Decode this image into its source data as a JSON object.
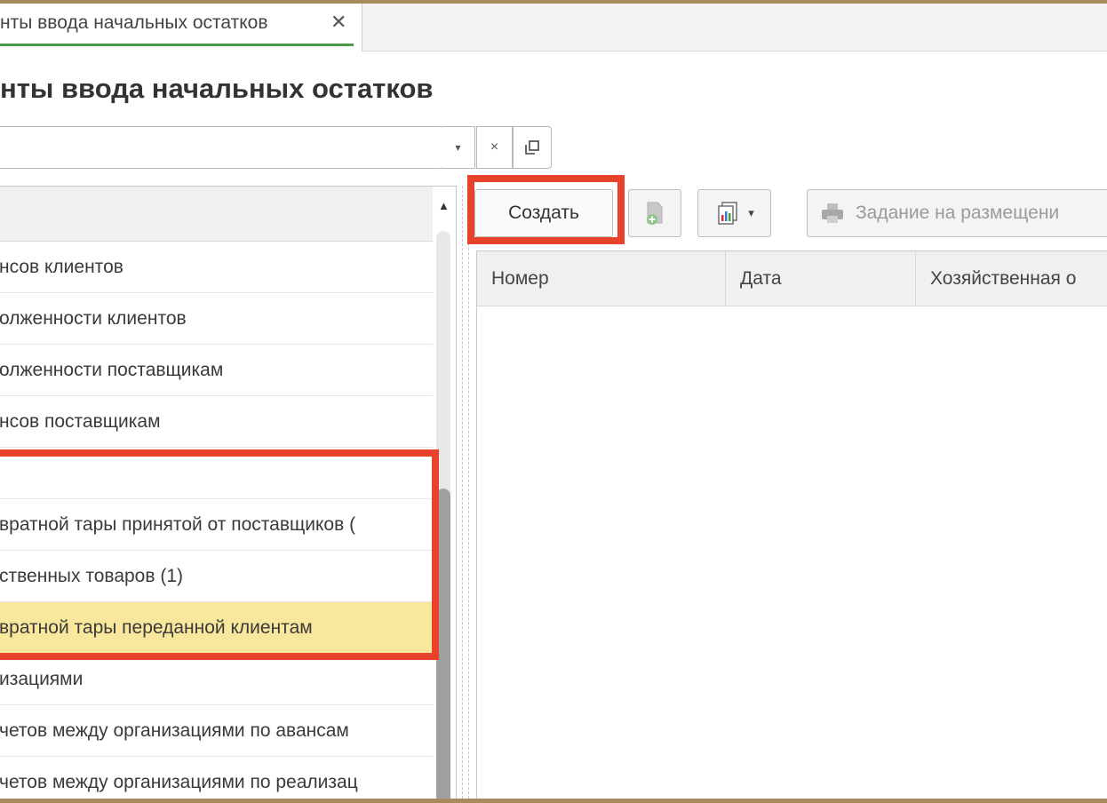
{
  "tab": {
    "title": "нты ввода начальных остатков",
    "close_glyph": "✕"
  },
  "page": {
    "title": "нты ввода начальных остатков"
  },
  "selector": {
    "dropdown_glyph": "▾",
    "clear_glyph": "×"
  },
  "list": {
    "scroll_up_glyph": "▲",
    "items": [
      {
        "label": "нсов клиентов",
        "selected": false
      },
      {
        "label": "олженности клиентов",
        "selected": false
      },
      {
        "label": "олженности поставщикам",
        "selected": false
      },
      {
        "label": "нсов поставщикам",
        "selected": false
      },
      {
        "label": "",
        "selected": false
      },
      {
        "label": "вратной тары принятой от поставщиков (",
        "selected": false
      },
      {
        "label": "ственных товаров (1)",
        "selected": false
      },
      {
        "label": "вратной тары переданной клиентам",
        "selected": true
      },
      {
        "label": "изациями",
        "selected": false
      },
      {
        "label": "четов между организациями по авансам",
        "selected": false
      },
      {
        "label": "четов между организациями по реализац",
        "selected": false
      }
    ]
  },
  "toolbar": {
    "create_label": "Создать",
    "report_dropdown_glyph": "▾",
    "print_label": "Задание на размещени"
  },
  "table": {
    "columns": [
      "Номер",
      "Дата",
      "Хозяйственная о"
    ]
  },
  "colors": {
    "highlight": "#e8412c",
    "selected_row": "#f8e79c",
    "tab_accent": "#4a9a44",
    "frame": "#a98a5e"
  }
}
